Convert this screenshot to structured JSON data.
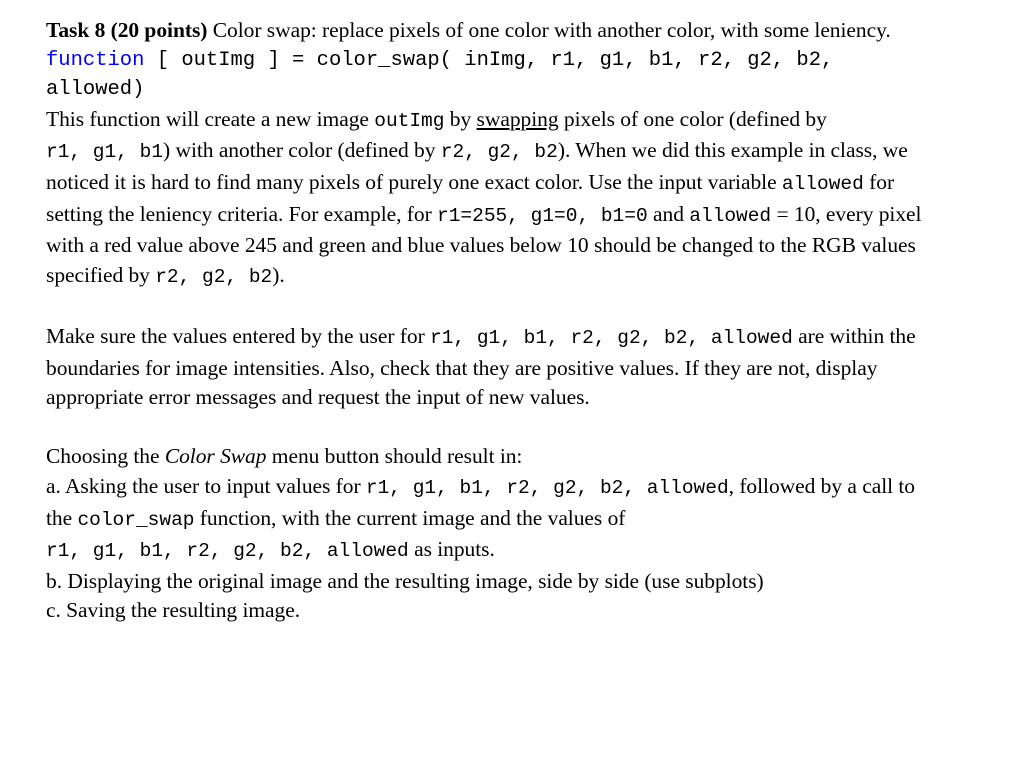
{
  "document": {
    "task_heading_bold": "Task 8 (20 points)",
    "task_heading_rest": " Color swap: replace pixels of one color with another color, with some leniency.",
    "code_signature": {
      "keyword": "function",
      "rest": " [ outImg ] = color_swap( inImg, r1, g1, b1, r2, g2, b2, allowed)"
    },
    "p1": {
      "s1": "This function will create a new image ",
      "c1": "outImg",
      "s2": " by ",
      "u1": "swapping",
      "s3": " pixels of one color (defined by ",
      "c2": "r1, g1, b1",
      "s4": ") with another color (defined by ",
      "c3": "r2, g2, b2",
      "s5": "). When we did this example in class, we noticed it is hard to find many pixels of purely one exact color. Use the input variable ",
      "c4": "allowed",
      "s6": " for setting the leniency criteria. For example, for ",
      "c5": "r1=255, g1=0, b1=0",
      "s7": " and ",
      "c6": "allowed",
      "s8": " = 10, every pixel with a red value above 245 and green and blue values below 10 should be changed to the RGB values specified by ",
      "c7": "r2, g2, b2",
      "s9": ")."
    },
    "p2": {
      "s1": "Make sure the values entered by the user for ",
      "c1": "r1, g1, b1, r2, g2, b2, allowed",
      "s2": "  are within the boundaries for image intensities. Also, check that they are positive values. If they are not, display appropriate error messages and request the input of new values."
    },
    "p3": {
      "s1": "Choosing the ",
      "i1": "Color Swap",
      "s2": " menu button should result in:"
    },
    "item_a": {
      "s1": "a. Asking the user to input values for ",
      "c1": "r1, g1, b1, r2, g2, b2, allowed",
      "s2": ", followed by a call to the ",
      "c2": "color_swap",
      "s3": " function, with the current image and the values of ",
      "c3": "r1, g1, b1, r2, g2, b2, allowed",
      "s4": " as inputs."
    },
    "item_b": "b. Displaying the original image and the resulting image, side by side (use subplots)",
    "item_c": "c. Saving the resulting image."
  },
  "colors": {
    "keyword_blue": "#0000FF",
    "text_black": "#000000",
    "page_background": "#FFFFFF"
  }
}
